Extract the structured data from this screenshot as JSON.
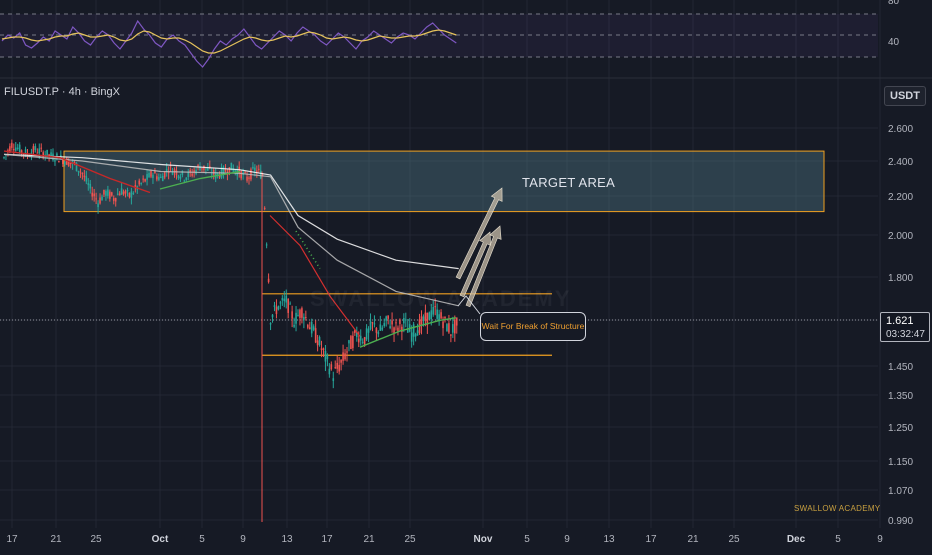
{
  "header": {
    "symbol": "FILUSDT.P · 4h · BingX",
    "currency": "USDT"
  },
  "price_tag": {
    "price": "1.621",
    "countdown": "03:32:47"
  },
  "annotations": {
    "target_area": "TARGET AREA",
    "callout": "Wait For Break of Structure"
  },
  "brand": {
    "footer": "SWALLOW ACADEMY",
    "watermark": "SWALLOW ACADEMY"
  },
  "colors": {
    "background": "#161a25",
    "zone_border": "#f0a020",
    "target_fill": "#5a8a96",
    "ema_fast": "#ffffff",
    "ema_slow": "#c0c0c0",
    "up_candle": "#26a69a",
    "down_candle": "#ef5350",
    "rsi_line": "#7e57c2",
    "rsi_signal": "#e6c35c"
  },
  "chart_data": [
    {
      "type": "candlestick",
      "title": "",
      "x_axis": {
        "tick_labels": [
          "17",
          "21",
          "25",
          "Oct",
          "5",
          "9",
          "13",
          "17",
          "21",
          "25",
          "Nov",
          "5",
          "9",
          "13",
          "17",
          "21",
          "25",
          "Dec",
          "5",
          "9"
        ]
      },
      "y_axis": {
        "tick_labels": [
          "2.600",
          "2.400",
          "2.200",
          "2.000",
          "1.800",
          "1.621",
          "1.450",
          "1.350",
          "1.250",
          "1.150",
          "1.070",
          "0.990"
        ],
        "ylim": [
          0.99,
          2.65
        ]
      },
      "key_levels": {
        "target_zone": [
          2.12,
          2.46
        ],
        "range_top": 1.73,
        "range_bottom": 1.49,
        "current_price": 1.621
      },
      "price_path": [
        [
          0,
          2.42
        ],
        [
          4,
          2.5
        ],
        [
          8,
          2.47
        ],
        [
          12,
          2.44
        ],
        [
          16,
          2.47
        ],
        [
          20,
          2.45
        ],
        [
          24,
          2.43
        ],
        [
          28,
          2.42
        ],
        [
          32,
          2.4
        ],
        [
          36,
          2.38
        ],
        [
          40,
          2.33
        ],
        [
          44,
          2.24
        ],
        [
          48,
          2.17
        ],
        [
          52,
          2.22
        ],
        [
          56,
          2.19
        ],
        [
          60,
          2.23
        ],
        [
          64,
          2.2
        ],
        [
          68,
          2.25
        ],
        [
          72,
          2.29
        ],
        [
          76,
          2.33
        ],
        [
          80,
          2.3
        ],
        [
          84,
          2.36
        ],
        [
          88,
          2.34
        ],
        [
          92,
          2.31
        ],
        [
          96,
          2.33
        ],
        [
          100,
          2.37
        ],
        [
          104,
          2.35
        ],
        [
          108,
          2.32
        ],
        [
          112,
          2.34
        ],
        [
          116,
          2.36
        ],
        [
          120,
          2.34
        ],
        [
          124,
          2.3
        ],
        [
          128,
          2.35
        ],
        [
          132,
          2.32
        ],
        [
          136,
          1.63
        ],
        [
          140,
          1.68
        ],
        [
          144,
          1.7
        ],
        [
          148,
          1.62
        ],
        [
          152,
          1.66
        ],
        [
          156,
          1.6
        ],
        [
          160,
          1.55
        ],
        [
          164,
          1.48
        ],
        [
          168,
          1.42
        ],
        [
          172,
          1.46
        ],
        [
          176,
          1.52
        ],
        [
          180,
          1.57
        ],
        [
          184,
          1.55
        ],
        [
          188,
          1.6
        ],
        [
          192,
          1.58
        ],
        [
          196,
          1.62
        ],
        [
          200,
          1.59
        ],
        [
          204,
          1.61
        ],
        [
          208,
          1.57
        ],
        [
          212,
          1.6
        ],
        [
          216,
          1.63
        ],
        [
          220,
          1.66
        ],
        [
          224,
          1.62
        ],
        [
          228,
          1.58
        ],
        [
          232,
          1.61
        ]
      ],
      "moving_averages": [
        {
          "points": [
            [
              0,
              2.44
            ],
            [
              40,
              2.42
            ],
            [
              80,
              2.38
            ],
            [
              120,
              2.35
            ],
            [
              136,
              2.32
            ],
            [
              150,
              2.1
            ],
            [
              170,
              1.98
            ],
            [
              200,
              1.88
            ],
            [
              232,
              1.84
            ]
          ]
        },
        {
          "points": [
            [
              0,
              2.44
            ],
            [
              40,
              2.4
            ],
            [
              80,
              2.34
            ],
            [
              120,
              2.33
            ],
            [
              136,
              2.31
            ],
            [
              150,
              2.04
            ],
            [
              170,
              1.88
            ],
            [
              200,
              1.74
            ],
            [
              232,
              1.68
            ]
          ]
        }
      ]
    },
    {
      "type": "line",
      "title": "",
      "y_axis": {
        "tick_labels": [
          "80",
          "40"
        ],
        "ylim": [
          20,
          90
        ]
      },
      "series": [
        {
          "values": [
            52,
            58,
            55,
            60,
            48,
            45,
            50,
            56,
            52,
            62,
            58,
            54,
            66,
            60,
            52,
            48,
            56,
            62,
            58,
            50,
            44,
            52,
            60,
            72,
            64,
            58,
            50,
            46,
            54,
            58,
            52,
            48,
            40,
            32,
            26,
            34,
            44,
            52,
            48,
            54,
            58,
            64,
            56,
            48,
            44,
            50,
            56,
            62,
            58,
            52,
            60,
            66,
            62,
            58,
            52,
            48,
            54,
            60,
            56,
            50,
            44,
            52,
            56,
            62,
            58,
            54,
            50,
            56,
            60,
            58,
            54,
            60,
            66,
            70,
            64,
            58,
            54,
            50
          ]
        },
        {
          "values": [
            54,
            55,
            56,
            56,
            55,
            53,
            52,
            53,
            54,
            56,
            57,
            57,
            59,
            60,
            58,
            56,
            56,
            57,
            58,
            56,
            53,
            52,
            54,
            59,
            62,
            61,
            58,
            55,
            54,
            55,
            55,
            53,
            50,
            46,
            42,
            40,
            40,
            42,
            45,
            48,
            51,
            54,
            56,
            55,
            53,
            52,
            53,
            55,
            57,
            56,
            57,
            59,
            61,
            60,
            58,
            55,
            54,
            55,
            56,
            55,
            53,
            52,
            53,
            55,
            57,
            56,
            55,
            55,
            56,
            57,
            57,
            58,
            60,
            62,
            63,
            62,
            60,
            58
          ]
        }
      ]
    }
  ]
}
